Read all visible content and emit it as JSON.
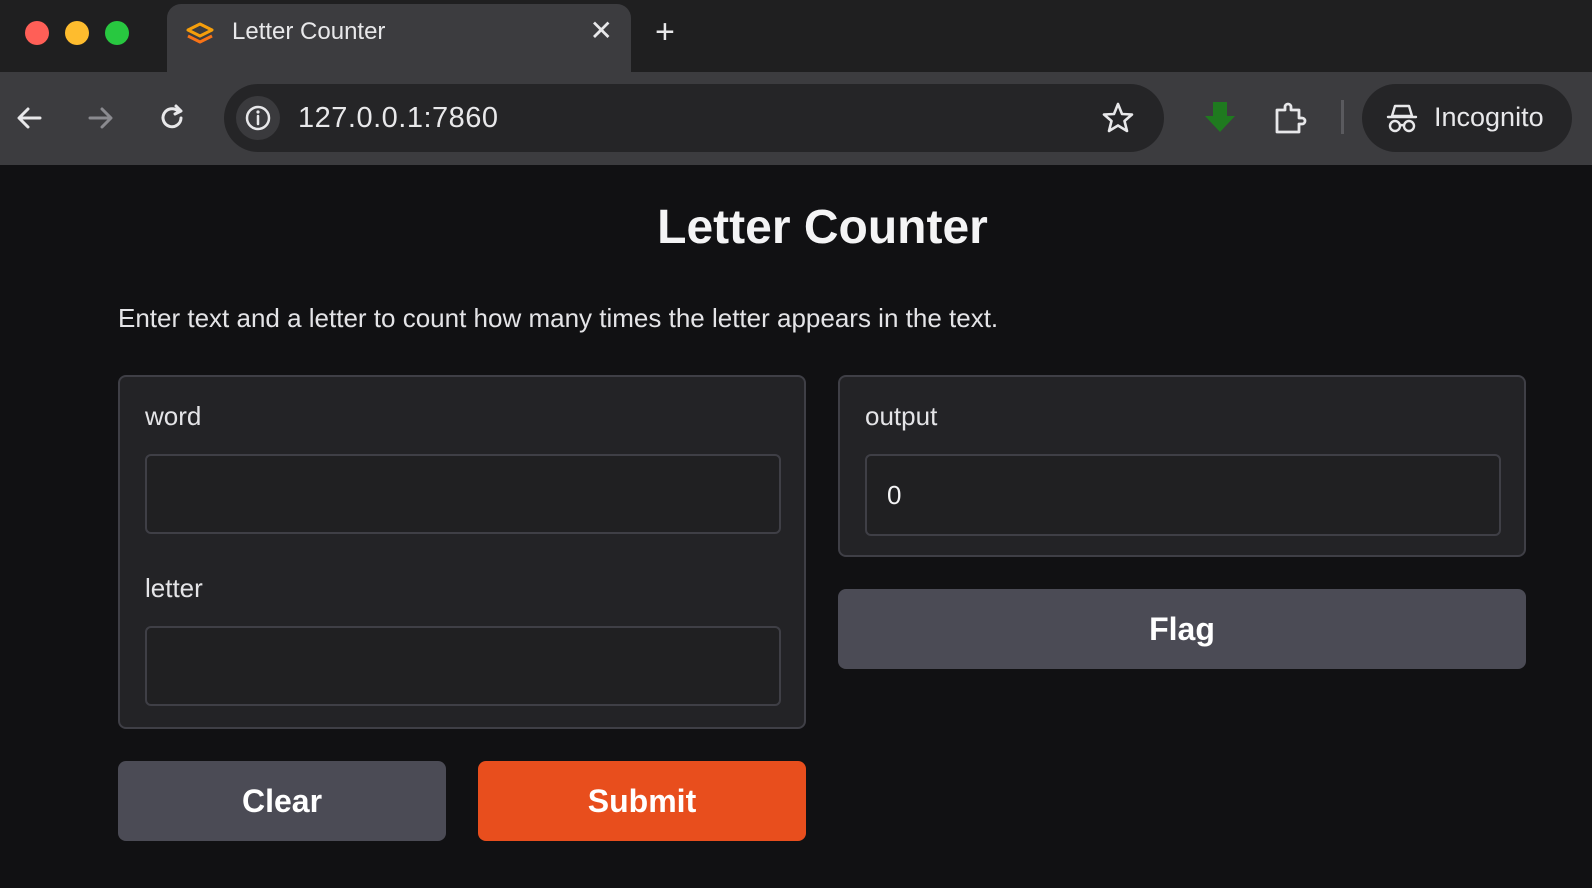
{
  "browser": {
    "tab_title": "Letter Counter",
    "url": "127.0.0.1:7860",
    "profile_label": "Incognito",
    "icons": [
      "back-icon",
      "forward-icon",
      "reload-icon",
      "site-info-icon",
      "bookmark-star-icon",
      "download-icon",
      "extensions-icon",
      "incognito-icon"
    ]
  },
  "app": {
    "title": "Letter Counter",
    "description": "Enter text and a letter to count how many times the letter appears in the text.",
    "inputs": {
      "word_label": "word",
      "word_value": "",
      "letter_label": "letter",
      "letter_value": ""
    },
    "output": {
      "label": "output",
      "value": "0"
    },
    "buttons": {
      "clear": "Clear",
      "submit": "Submit",
      "flag": "Flag"
    }
  },
  "colors": {
    "accent": "#e84e1d",
    "secondary_button": "#4b4b55",
    "background": "#111113",
    "panel": "#232326"
  }
}
